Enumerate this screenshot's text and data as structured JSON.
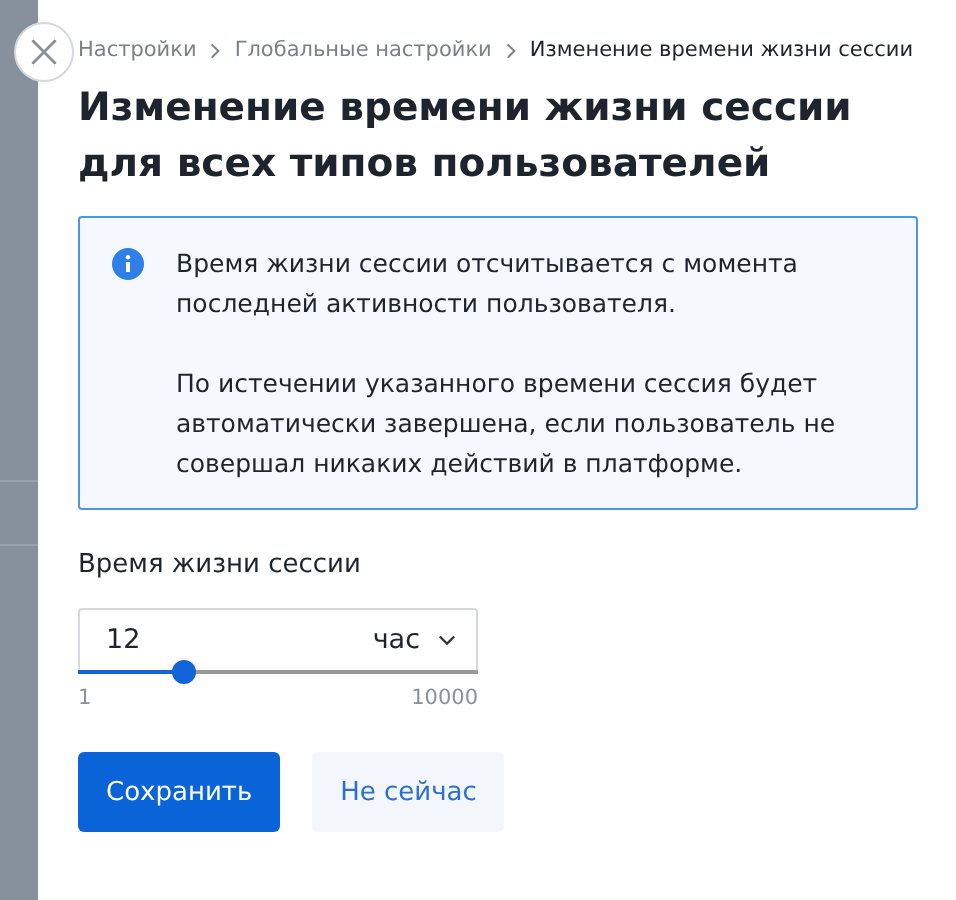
{
  "breadcrumbs": [
    {
      "label": "Настройки",
      "current": false
    },
    {
      "label": "Глобальные настройки",
      "current": false
    },
    {
      "label": "Изменение времени жизни сессии",
      "current": true
    }
  ],
  "title": "Изменение времени жизни сессии для всех типов пользователей",
  "info": {
    "paragraphs": [
      "Время жизни сессии отсчитывается с момента последней активности пользователя.",
      "По истечении указанного времени сессия будет автоматически завершена, если пользователь не совершал никаких действий в платформе."
    ]
  },
  "session_field": {
    "label": "Время жизни сессии",
    "value": "12",
    "unit": "час",
    "level": 0.265,
    "min_label": "1",
    "max_label": "10000"
  },
  "buttons": [
    {
      "label": "Сохранить",
      "kind": "primary"
    },
    {
      "label": "Не сейчас",
      "kind": "secondary"
    }
  ]
}
